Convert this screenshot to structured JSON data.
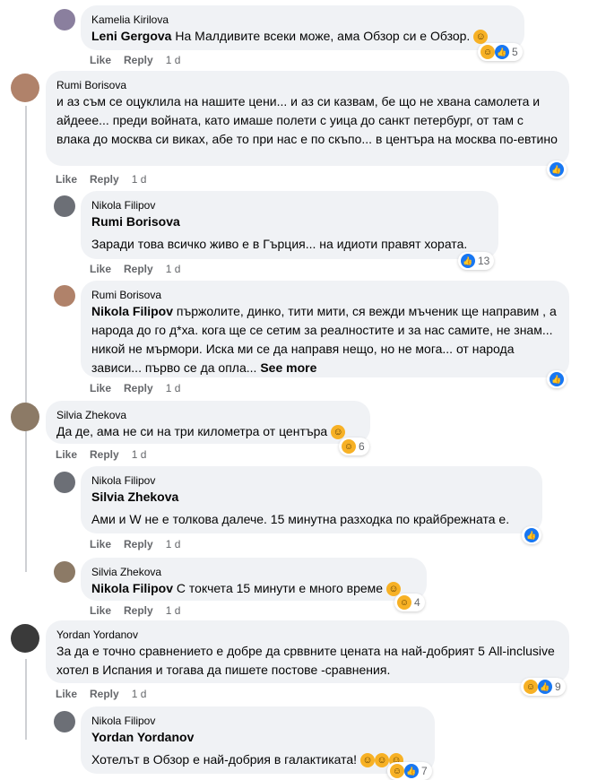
{
  "actions": {
    "like": "Like",
    "reply": "Reply"
  },
  "comments": [
    {
      "author": "Kamelia Kirilova",
      "tag": "Leni Gergova",
      "text": " На Малдивите всеки може, ама Обзор си е Обзор.",
      "time": "1 d",
      "reacts": "5"
    },
    {
      "author": "Rumi Borisova",
      "text": "и аз съм се оцуклила на нашите цени... и аз си казвам, бе що не хвана самолета и айдеее... преди войната, като имаше полети с уица до санкт петербург, от там с влака до москва си виках, абе то при нас е по скъпо... в центъра на москва по-евтино",
      "time": "1 d"
    },
    {
      "author": "Nikola Filipov",
      "tag": "Rumi Borisova",
      "text": "Заради това всичко живо е в Гърция... на идиоти правят хората.",
      "time": "1 d",
      "reacts": "13"
    },
    {
      "author": "Rumi Borisova",
      "tag": "Nikola Filipov",
      "text": " пържолите, динко, тити мити, ся вежди мъченик ще направим , а народа до го д*ха. кога ще се сетим за реалностите и за нас самите, не знам... никой не мърмори. Иска ми се да направя нещо, но не мога... от народа зависи... първо се да опла...",
      "more": "See more",
      "time": "1 d"
    },
    {
      "author": "Silvia Zhekova",
      "text": "Да де, ама не си на три километра от центъра",
      "time": "1 d",
      "reacts": "6"
    },
    {
      "author": "Nikola Filipov",
      "tag": "Silvia Zhekova",
      "text": "Ами и W не е толкова далече. 15 минутна разходка по крайбрежната е.",
      "time": "1 d"
    },
    {
      "author": "Silvia Zhekova",
      "tag": "Nikola Filipov",
      "text": " С токчета 15 минути е много време",
      "time": "1 d",
      "reacts": "4"
    },
    {
      "author": "Yordan Yordanov",
      "text": "За да е точно сравнението е добре да срввните цената на най-добрият 5 All-inclusive хотел в Испания и тогава да пишете постове -сравнения.",
      "time": "1 d",
      "reacts": "9"
    },
    {
      "author": "Nikola Filipov",
      "tag": "Yordan Yordanov",
      "text": "Хотелът в Обзор е най-добрия в галактиката!",
      "reacts": "7"
    }
  ]
}
